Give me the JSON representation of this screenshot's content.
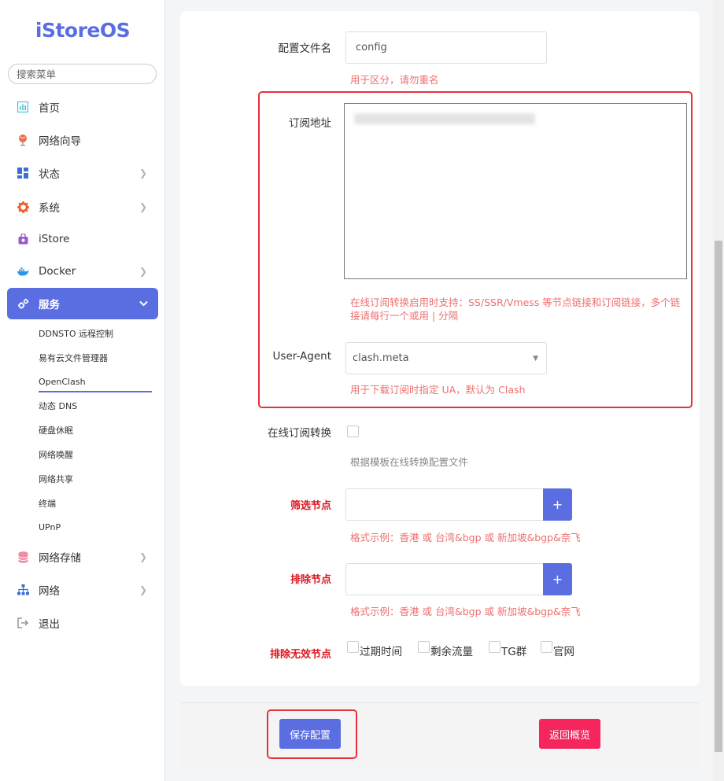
{
  "brand": {
    "logo_text": "iStoreOS",
    "accent": "#5b6ee1"
  },
  "sidebar": {
    "search_placeholder": "搜索菜单",
    "items": [
      {
        "label": "首页",
        "icon": "dashboard-icon"
      },
      {
        "label": "网络向导",
        "icon": "globe-icon"
      },
      {
        "label": "状态",
        "icon": "grid-icon"
      },
      {
        "label": "系统",
        "icon": "gear-icon"
      },
      {
        "label": "iStore",
        "icon": "store-bag-icon"
      },
      {
        "label": "Docker",
        "icon": "docker-whale-icon"
      },
      {
        "label": "服务",
        "icon": "gears-icon"
      },
      {
        "label": "网络存储",
        "icon": "database-icon"
      },
      {
        "label": "网络",
        "icon": "network-tree-icon"
      },
      {
        "label": "退出",
        "icon": "logout-icon"
      }
    ],
    "sub_items": [
      "DDNSTO 远程控制",
      "易有云文件管理器",
      "OpenClash",
      "动态 DNS",
      "硬盘休眠",
      "网络唤醒",
      "网络共享",
      "终端",
      "UPnP"
    ]
  },
  "form": {
    "config_name": {
      "label": "配置文件名",
      "value": "config",
      "hint": "用于区分，请勿重名"
    },
    "subscribe_url": {
      "label": "订阅地址",
      "value": "http://...",
      "hint": "在线订阅转换启用时支持：SS/SSR/Vmess 等节点链接和订阅链接，多个链接请每行一个或用 | 分隔"
    },
    "user_agent": {
      "label": "User-Agent",
      "value": "clash.meta",
      "hint": "用于下载订阅时指定 UA，默认为 Clash"
    },
    "online_convert": {
      "label": "在线订阅转换",
      "hint": "根据模板在线转换配置文件"
    },
    "filter_nodes": {
      "label": "筛选节点",
      "hint": "格式示例：香港 或 台湾&bgp 或 新加坡&bgp&奈飞",
      "button": "+"
    },
    "exclude_nodes": {
      "label": "排除节点",
      "hint": "格式示例：香港 或 台湾&bgp 或 新加坡&bgp&奈飞",
      "button": "+"
    },
    "exclude_invalid": {
      "label": "排除无效节点",
      "options": [
        "过期时间",
        "剩余流量",
        "TG群",
        "官网"
      ]
    }
  },
  "footer": {
    "save_label": "保存配置",
    "back_label": "返回概览"
  }
}
